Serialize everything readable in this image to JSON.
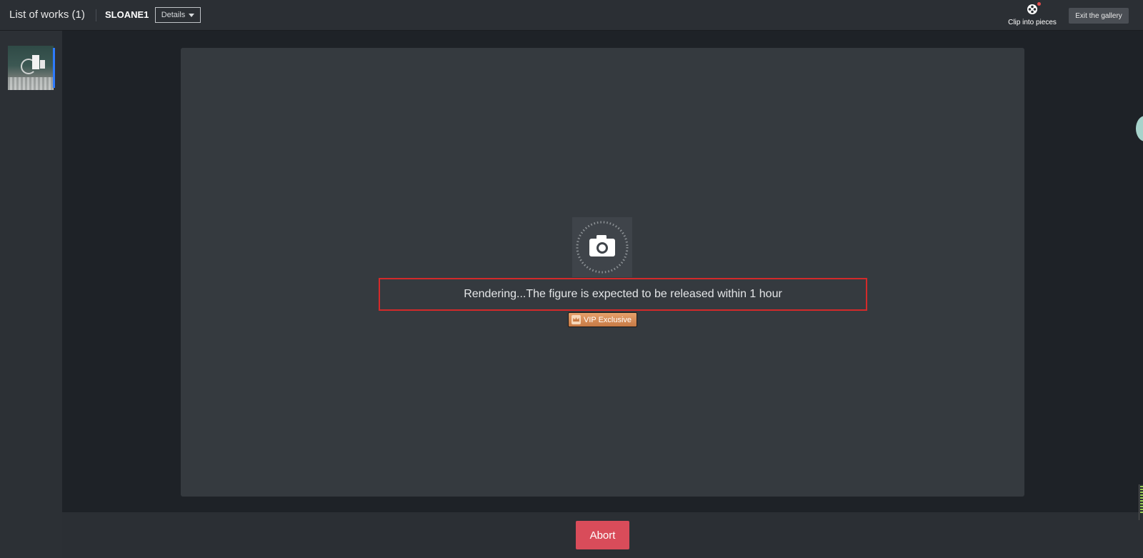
{
  "header": {
    "works_title": "List of works (1)",
    "project_name": "SLOANE1",
    "details_label": "Details",
    "clip_label": "Clip into pieces",
    "exit_label": "Exit the gallery"
  },
  "canvas": {
    "status_text": "Rendering...The figure is expected to be released within 1 hour",
    "vip_label": "VIP Exclusive"
  },
  "footer": {
    "abort_label": "Abort"
  },
  "colors": {
    "abort": "#d94c5a",
    "highlight_border": "#d42a2a",
    "vip_badge": "#d88b55",
    "selected_indicator": "#2e7bff"
  },
  "icons": [
    "film-reel-icon",
    "camera-icon",
    "crown-icon",
    "caret-down-icon"
  ]
}
